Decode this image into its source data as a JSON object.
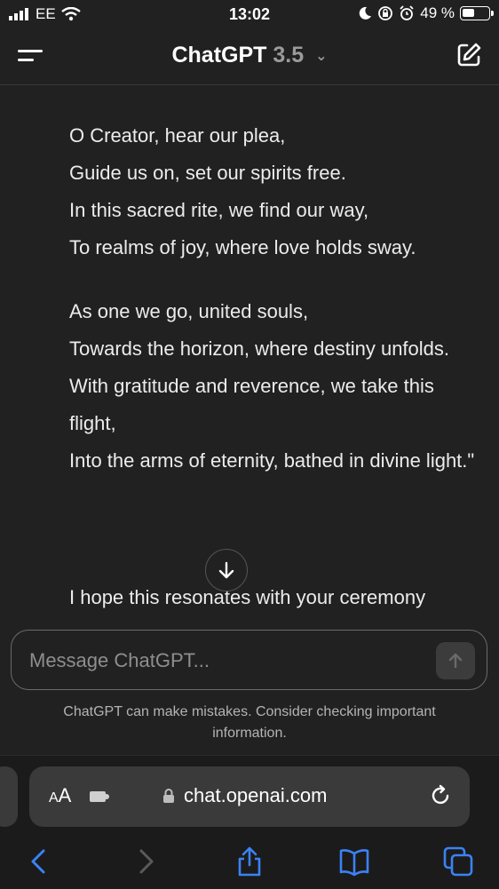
{
  "status_bar": {
    "carrier": "EE",
    "time": "13:02",
    "battery_percent": "49 %",
    "battery_level": 0.49
  },
  "header": {
    "title": "ChatGPT",
    "version": "3.5"
  },
  "message": {
    "stanza1": [
      "O Creator, hear our plea,",
      "Guide us on, set our spirits free.",
      "In this sacred rite, we find our way,",
      "To realms of joy, where love holds sway."
    ],
    "stanza2": [
      "As one we go, united souls,",
      "Towards the horizon, where destiny unfolds.",
      "With gratitude and reverence, we take this flight,",
      "Into the arms of eternity, bathed in divine light.\""
    ],
    "closing": "I hope this resonates with your ceremony"
  },
  "composer": {
    "placeholder": "Message ChatGPT..."
  },
  "disclaimer": "ChatGPT can make mistakes. Consider checking important information.",
  "browser": {
    "aa_label_small": "A",
    "aa_label_large": "A",
    "url": "chat.openai.com"
  }
}
